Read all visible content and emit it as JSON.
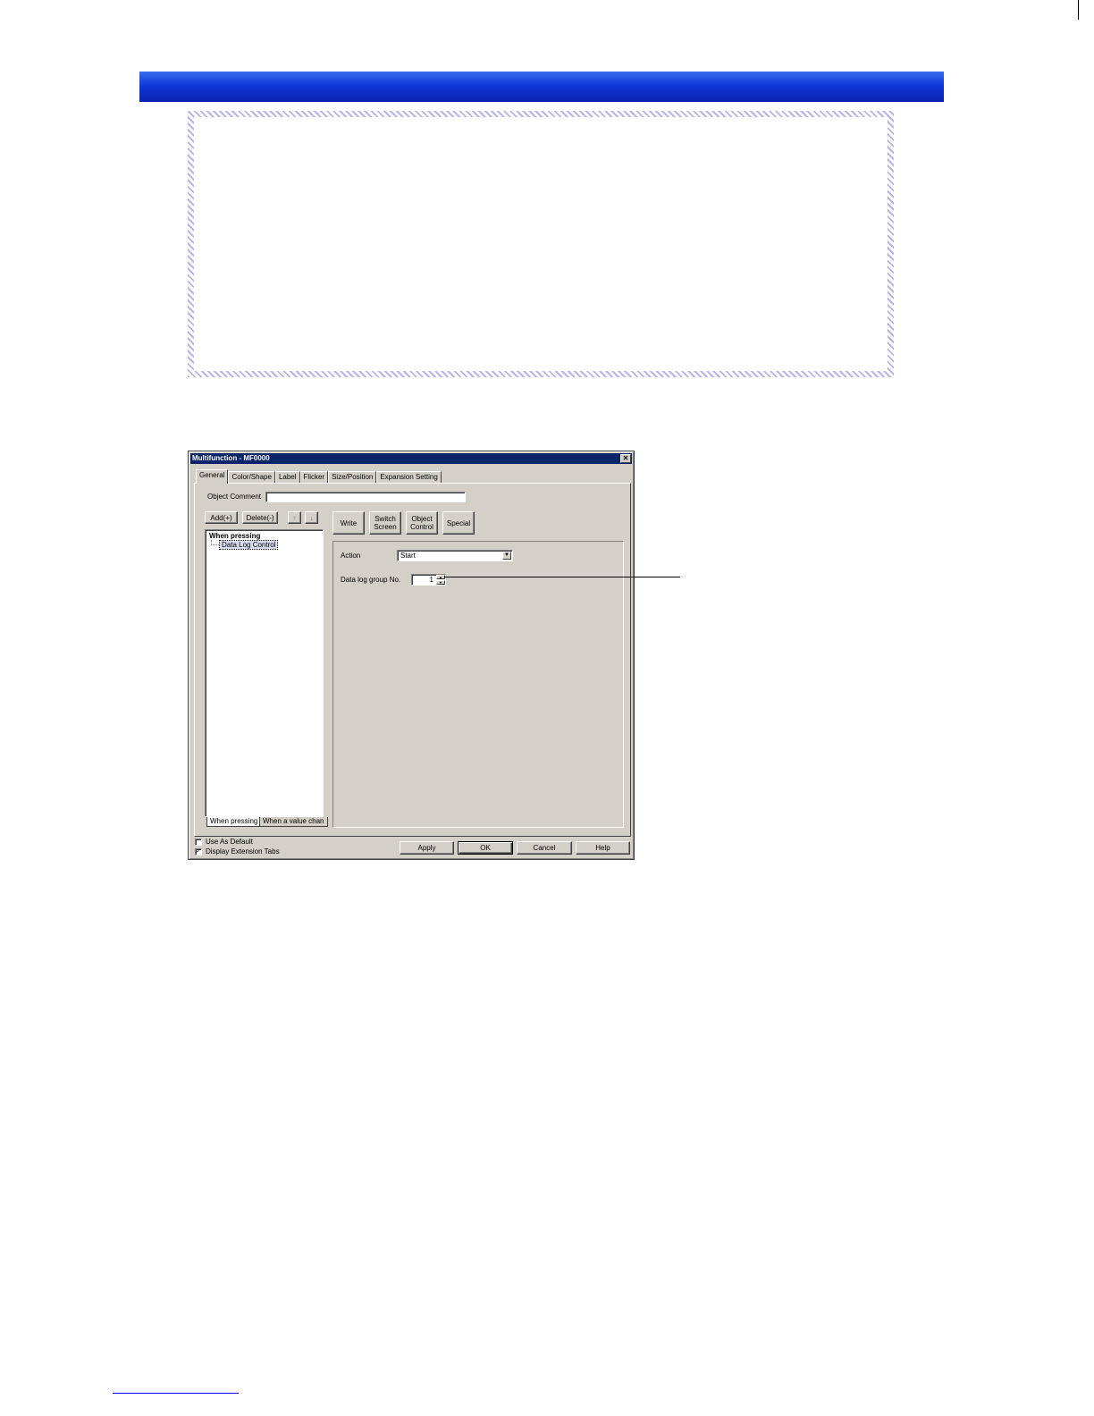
{
  "dialog": {
    "title": "Multifunction - MF0000",
    "close_glyph": "✕",
    "tabs": [
      "General",
      "Color/Shape",
      "Label",
      "Flicker",
      "Size/Position",
      "Expansion Setting"
    ],
    "object_comment_label": "Object Comment",
    "object_comment_value": "",
    "add_label": "Add(+)",
    "delete_label": "Delete(-)",
    "move_up_glyph": "↑",
    "move_down_glyph": "↓",
    "tree": {
      "root": "When pressing",
      "child": "Data Log Control"
    },
    "bottom_tabs": [
      "When pressing",
      "When a value chan"
    ],
    "function_buttons": {
      "write": "Write",
      "switch_screen_1": "Switch",
      "switch_screen_2": "Screen",
      "object_control_1": "Object",
      "object_control_2": "Control",
      "special": "Special"
    },
    "action_label": "Action",
    "action_value": "Start",
    "data_log_group_label": "Data log group No.",
    "data_log_group_value": "1",
    "use_as_default_label": "Use As Default",
    "use_as_default_checked": false,
    "display_extension_tabs_label": "Display Extension Tabs",
    "display_extension_tabs_checked": true,
    "check_glyph": "✓",
    "apply_label": "Apply",
    "ok_label": "OK",
    "cancel_label": "Cancel",
    "help_label": "Help"
  },
  "colors": {
    "header_bar": "#1038d8",
    "note_border": "#b8b4ea",
    "title_bar": "#0a246a",
    "dialog_face": "#d4d0c8"
  }
}
